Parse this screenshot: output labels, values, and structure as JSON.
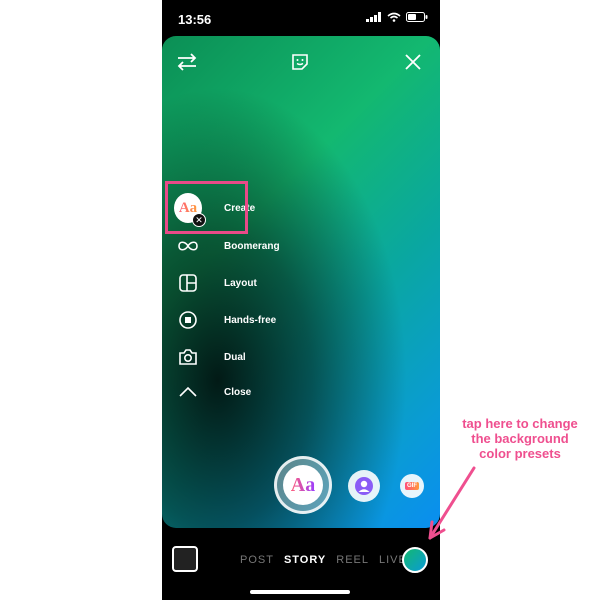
{
  "status_bar": {
    "time": "13:56"
  },
  "top_bar": {
    "flip_icon": "flip-camera-icon",
    "sticker_icon": "sticker-icon",
    "close_icon": "close-icon"
  },
  "menu": {
    "items": [
      {
        "label": "Create",
        "icon": "create-text-icon"
      },
      {
        "label": "Boomerang",
        "icon": "infinity-icon"
      },
      {
        "label": "Layout",
        "icon": "layout-icon"
      },
      {
        "label": "Hands-free",
        "icon": "record-icon"
      },
      {
        "label": "Dual",
        "icon": "dual-camera-icon"
      },
      {
        "label": "Close",
        "icon": "chevron-up-icon"
      }
    ],
    "create_badge": "Aa"
  },
  "capture": {
    "label": "Aa"
  },
  "gif_label": "GIF",
  "modes": [
    "POST",
    "STORY",
    "REEL",
    "LIVE"
  ],
  "active_mode": "STORY",
  "annotation": {
    "lines": [
      "tap here to change",
      "the background",
      "color presets"
    ],
    "color": "#ef4f8f"
  },
  "colors": {
    "highlight": "#e84a88",
    "gradient_start": "#0b8f55",
    "gradient_end": "#0a8ef0"
  }
}
